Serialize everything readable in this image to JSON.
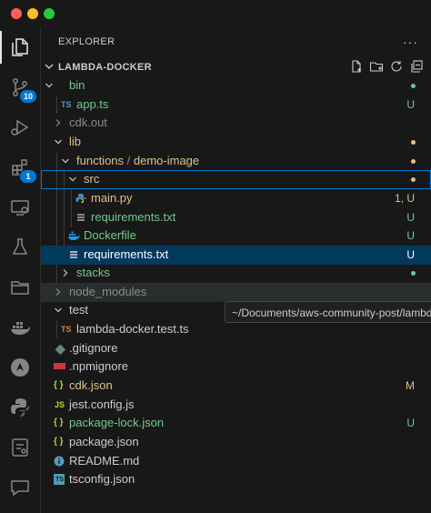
{
  "window": {
    "lights": [
      "#ff5f57",
      "#febc2e",
      "#28c840"
    ]
  },
  "activity_bar": {
    "items": [
      {
        "icon": "files-icon",
        "badge": ""
      },
      {
        "icon": "source-control-icon",
        "badge": "10"
      },
      {
        "icon": "run-debug-icon",
        "badge": ""
      },
      {
        "icon": "extensions-icon",
        "badge": "1"
      },
      {
        "icon": "remote-explorer-icon",
        "badge": ""
      },
      {
        "icon": "testing-icon",
        "badge": ""
      },
      {
        "icon": "folder-icon",
        "badge": ""
      },
      {
        "icon": "docker-icon",
        "badge": ""
      },
      {
        "icon": "aws-icon",
        "badge": ""
      },
      {
        "icon": "python-icon",
        "badge": ""
      },
      {
        "icon": "cdk-icon",
        "badge": ""
      },
      {
        "icon": "chat-icon",
        "badge": ""
      }
    ]
  },
  "explorer": {
    "title": "EXPLORER",
    "more": "···",
    "section_title": "LAMBDA-DOCKER"
  },
  "tree": [
    {
      "name": "bin",
      "type": "folder",
      "open": true,
      "color": "#73c991",
      "status": "dot",
      "status_color": "#73c991"
    },
    {
      "name": "app.ts",
      "type": "ts",
      "color": "#73c991",
      "status": "U",
      "status_color": "#73c991"
    },
    {
      "name": "cdk.out",
      "type": "folder",
      "open": false,
      "color": "#8c8c8c",
      "status": "",
      "status_color": ""
    },
    {
      "name": "lib",
      "type": "folder",
      "open": true,
      "color": "#e2c08d",
      "status": "dot",
      "status_color": "#e2c08d"
    },
    {
      "name": "functions",
      "name2": "demo-image",
      "type": "folder",
      "open": true,
      "color": "#e2c08d",
      "status": "dot",
      "status_color": "#e2c08d"
    },
    {
      "name": "src",
      "type": "folder",
      "open": true,
      "color": "#e2c08d",
      "status": "dot",
      "status_color": "#e2c08d"
    },
    {
      "name": "main.py",
      "type": "py",
      "color": "#e2c08d",
      "status": "1, U",
      "status_color": "#e2c08d"
    },
    {
      "name": "requirements.txt",
      "type": "txt",
      "color": "#73c991",
      "status": "U",
      "status_color": "#73c991"
    },
    {
      "name": "Dockerfile",
      "type": "docker",
      "color": "#73c991",
      "status": "U",
      "status_color": "#73c991"
    },
    {
      "name": "requirements.txt",
      "type": "txt",
      "color": "#ffffff",
      "status": "U",
      "status_color": "#ffffff"
    },
    {
      "name": "stacks",
      "type": "folder",
      "open": false,
      "color": "#73c991",
      "status": "dot",
      "status_color": "#73c991"
    },
    {
      "name": "node_modules",
      "type": "folder",
      "open": false,
      "color": "#8c8c8c",
      "status": "",
      "status_color": ""
    },
    {
      "name": "test",
      "type": "folder",
      "open": true,
      "color": "#cccccc",
      "status": "",
      "status_color": ""
    },
    {
      "name": "lambda-docker.test.ts",
      "type": "test",
      "color": "#cccccc",
      "status": "",
      "status_color": ""
    },
    {
      "name": ".gitignore",
      "type": "git",
      "color": "#cccccc",
      "status": "",
      "status_color": ""
    },
    {
      "name": ".npmignore",
      "type": "npm",
      "color": "#cccccc",
      "status": "",
      "status_color": ""
    },
    {
      "name": "cdk.json",
      "type": "json",
      "color": "#e2c08d",
      "status": "M",
      "status_color": "#e2c08d"
    },
    {
      "name": "jest.config.js",
      "type": "js",
      "color": "#cccccc",
      "status": "",
      "status_color": ""
    },
    {
      "name": "package-lock.json",
      "type": "json",
      "color": "#73c991",
      "status": "U",
      "status_color": "#73c991"
    },
    {
      "name": "package.json",
      "type": "json",
      "color": "#cccccc",
      "status": "",
      "status_color": ""
    },
    {
      "name": "README.md",
      "type": "info",
      "color": "#cccccc",
      "status": "",
      "status_color": ""
    },
    {
      "name": "tsconfig.json",
      "type": "tsconfig",
      "color": "#cccccc",
      "status": "",
      "status_color": ""
    }
  ],
  "tooltip": "~/Documents/aws-community-post/lambda-docker/node_modules",
  "colors": {
    "selection": "#04395e",
    "focus_border": "#0078d4",
    "untracked": "#73c991",
    "modified": "#e2c08d"
  }
}
